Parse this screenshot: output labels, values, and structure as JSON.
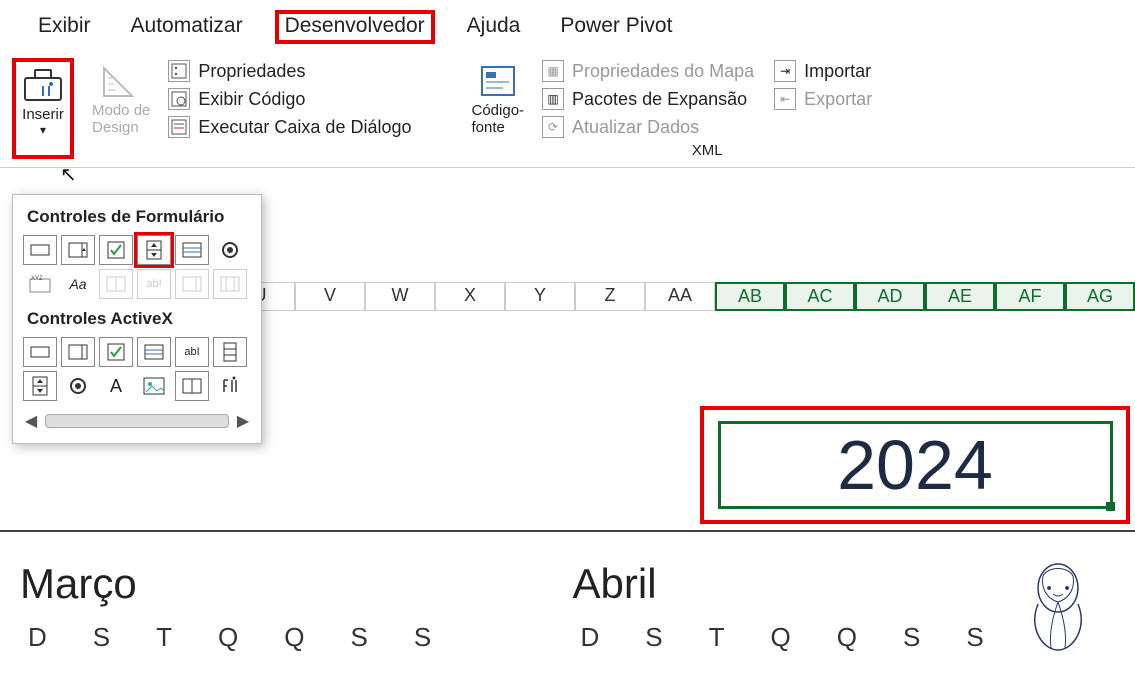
{
  "tabs": {
    "exibir": "Exibir",
    "automatizar": "Automatizar",
    "desenvolvedor": "Desenvolvedor",
    "ajuda": "Ajuda",
    "power_pivot": "Power Pivot"
  },
  "ribbon": {
    "inserir": "Inserir",
    "modo_design": "Modo de\nDesign",
    "propriedades": "Propriedades",
    "exibir_codigo": "Exibir Código",
    "executar_caixa": "Executar Caixa de Diálogo",
    "codigo_fonte": "Código-\nfonte",
    "prop_mapa": "Propriedades do Mapa",
    "pacotes_expansao": "Pacotes de Expansão",
    "atualizar_dados": "Atualizar Dados",
    "importar": "Importar",
    "exportar": "Exportar",
    "xml": "XML"
  },
  "dropdown": {
    "form_title": "Controles de Formulário",
    "activex_title": "Controles ActiveX",
    "label_aa": "Aa",
    "label_xyz": "XYZ",
    "label_abl": "abI",
    "label_a": "A"
  },
  "columns": [
    "U",
    "V",
    "W",
    "X",
    "Y",
    "Z",
    "AA",
    "AB",
    "AC",
    "AD",
    "AE",
    "AF",
    "AG"
  ],
  "selected_cols": [
    "AB",
    "AC",
    "AD",
    "AE",
    "AF",
    "AG"
  ],
  "year": "2024",
  "months": {
    "march": "Março",
    "april": "Abril"
  },
  "weekdays": [
    "D",
    "S",
    "T",
    "Q",
    "Q",
    "S",
    "S"
  ]
}
